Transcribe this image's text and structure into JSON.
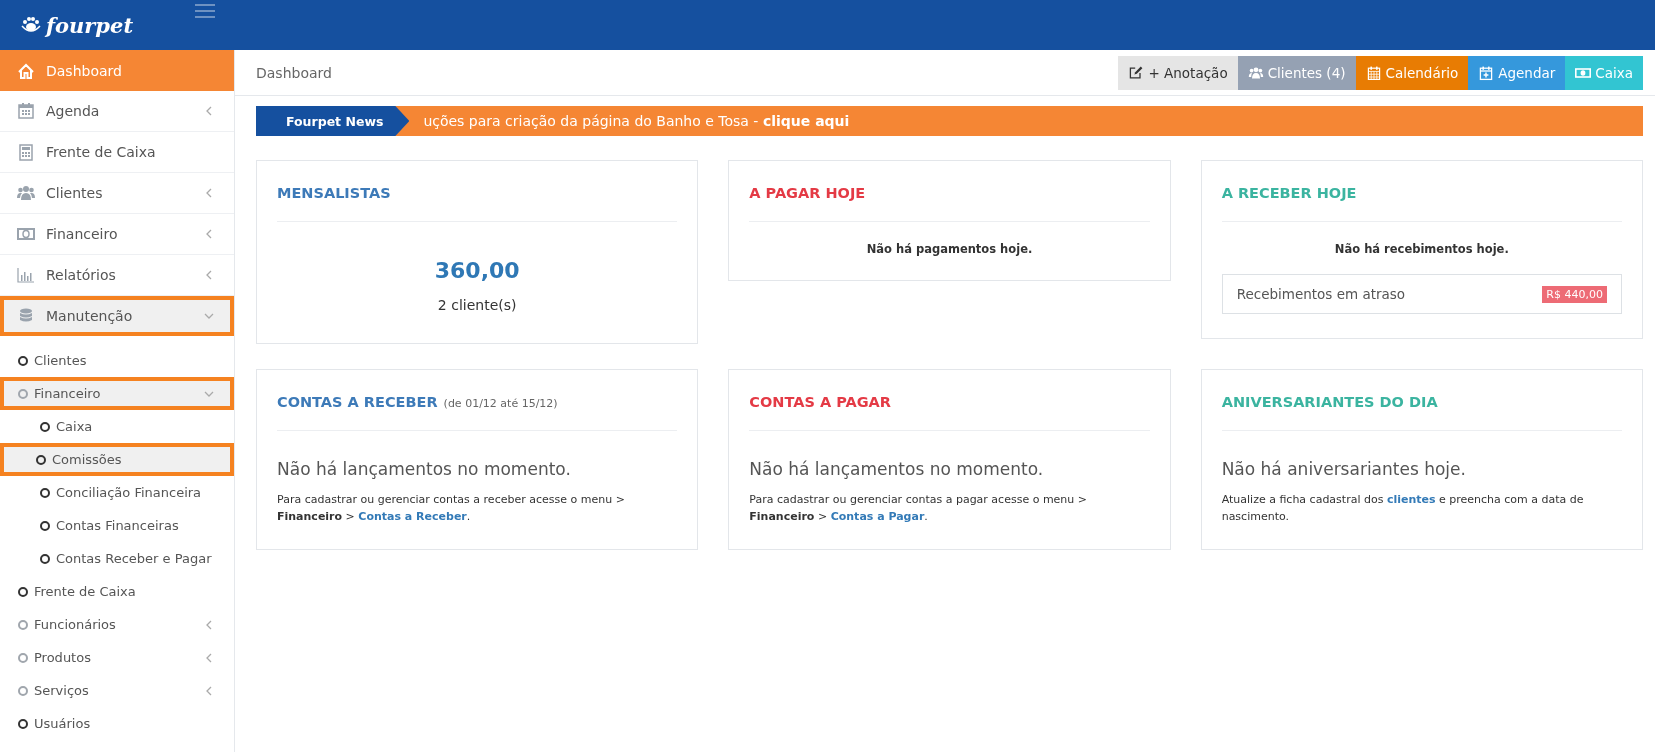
{
  "brand": {
    "name": "fourpet"
  },
  "sidebar": {
    "items": [
      {
        "label": "Dashboard",
        "selected": true
      },
      {
        "label": "Agenda",
        "selected": false,
        "expanded": false
      },
      {
        "label": "Frente de Caixa",
        "selected": false
      },
      {
        "label": "Clientes",
        "selected": false,
        "expanded": false
      },
      {
        "label": "Financeiro",
        "selected": false,
        "expanded": false
      },
      {
        "label": "Relatórios",
        "selected": false,
        "expanded": false
      },
      {
        "label": "Manutenção",
        "selected": false,
        "expanded": true,
        "highlighted": true,
        "children": [
          {
            "label": "Clientes",
            "highlighted": false
          },
          {
            "label": "Financeiro",
            "expanded": true,
            "highlighted": true,
            "children": [
              {
                "label": "Caixa",
                "highlighted": false
              },
              {
                "label": "Comissões",
                "highlighted": true
              },
              {
                "label": "Conciliação Financeira",
                "highlighted": false
              },
              {
                "label": "Contas Financeiras",
                "highlighted": false
              },
              {
                "label": "Contas Receber e Pagar",
                "highlighted": false
              }
            ]
          },
          {
            "label": "Frente de Caixa",
            "highlighted": false
          },
          {
            "label": "Funcionários",
            "expanded": false,
            "highlighted": false
          },
          {
            "label": "Produtos",
            "expanded": false,
            "highlighted": false
          },
          {
            "label": "Serviços",
            "expanded": false,
            "highlighted": false
          },
          {
            "label": "Usuários",
            "highlighted": false
          }
        ]
      }
    ]
  },
  "breadcrumb": "Dashboard",
  "actions": [
    {
      "label": "+ Anotação",
      "color": "#e5e5e5"
    },
    {
      "label": "Clientes (4)",
      "color": "#95a1b3"
    },
    {
      "label": "Calendário",
      "color": "#e87c03"
    },
    {
      "label": "Agendar",
      "color": "#3598dc"
    },
    {
      "label": "Caixa",
      "color": "#32c5d2"
    }
  ],
  "news": {
    "label": "Fourpet News",
    "text": "uções para criação da página do Banho e Tosa - **clique aqui**"
  },
  "cards": [
    {
      "title": "MENSALISTAS",
      "color": "#3d7ab8",
      "kind": "value",
      "value": "360,00",
      "caption": "2 cliente(s)"
    },
    {
      "title": "A PAGAR HOJE",
      "color": "#e43a45",
      "kind": "message",
      "message": "Não há pagamentos hoje."
    },
    {
      "title": "A RECEBER HOJE",
      "color": "#3bb4a0",
      "kind": "message",
      "message": "Não há recebimentos hoje.",
      "row": {
        "label": "Recebimentos em atraso",
        "badge": "R$ 440,00"
      }
    },
    {
      "title": "CONTAS A RECEBER",
      "note": "(de 01/12 até 15/12)",
      "color": "#3d7ab8",
      "kind": "empty",
      "message": "Não há lançamentos no momento.",
      "help": [
        {
          "kind": "plain",
          "text": "Para cadastrar ou gerenciar contas a receber acesse o menu > "
        },
        {
          "kind": "bold",
          "text": "Financeiro"
        },
        {
          "kind": "plain",
          "text": " > "
        },
        {
          "kind": "link",
          "text": "Contas a Receber"
        },
        {
          "kind": "plain",
          "text": "."
        }
      ]
    },
    {
      "title": "CONTAS A PAGAR",
      "color": "#e43a45",
      "kind": "empty",
      "message": "Não há lançamentos no momento.",
      "help": [
        {
          "kind": "plain",
          "text": "Para cadastrar ou gerenciar contas a pagar acesse o menu > "
        },
        {
          "kind": "bold",
          "text": "Financeiro"
        },
        {
          "kind": "plain",
          "text": " > "
        },
        {
          "kind": "link",
          "text": "Contas a Pagar"
        },
        {
          "kind": "plain",
          "text": "."
        }
      ]
    },
    {
      "title": "ANIVERSARIANTES DO DIA",
      "color": "#3bb4a0",
      "kind": "empty",
      "message": "Não há aniversariantes hoje.",
      "help": [
        {
          "kind": "plain",
          "text": "Atualize a ficha cadastral dos "
        },
        {
          "kind": "link",
          "text": "clientes"
        },
        {
          "kind": "plain",
          "text": " e preencha com a data de nascimento."
        }
      ]
    }
  ]
}
